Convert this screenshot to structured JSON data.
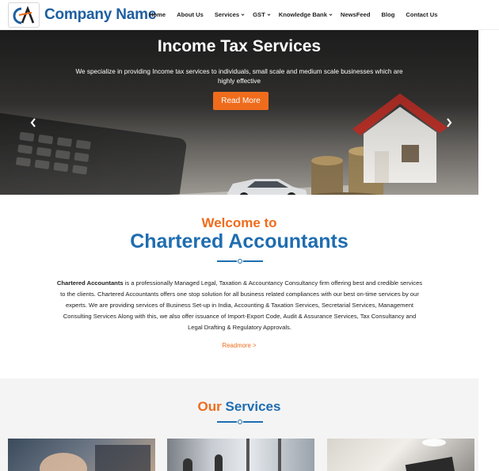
{
  "brand": {
    "name": "Company Name",
    "logo_letters": "CA"
  },
  "nav": {
    "items": [
      {
        "label": "Home",
        "dropdown": false
      },
      {
        "label": "About Us",
        "dropdown": false
      },
      {
        "label": "Services",
        "dropdown": true
      },
      {
        "label": "GST",
        "dropdown": true
      },
      {
        "label": "Knowledge Bank",
        "dropdown": true
      },
      {
        "label": "NewsFeed",
        "dropdown": false
      },
      {
        "label": "Blog",
        "dropdown": false
      },
      {
        "label": "Contact Us",
        "dropdown": false
      }
    ]
  },
  "hero": {
    "title": "Income Tax Services",
    "subtitle": "We specialize in providing Income tax services to individuals, small scale and medium scale businesses which are highly effective",
    "button": "Read More"
  },
  "welcome": {
    "top": "Welcome to",
    "main": "Chartered Accountants",
    "about_bold": "Chartered Accountants",
    "about_rest": " is a professionally Managed Legal, Taxation & Accountancy Consultancy firm offering best and credible services to the clients. Chartered Accountants offers one stop solution for all business related compliances with our best on-time services by our experts. We are providing services of Business Set-up in India, Accounting & Taxation Services, Secretarial Services, Management Consulting Services Along with this, we also offer issuance of Import-Export Code, Audit & Assurance Services, Tax Consultancy and Legal Drafting & Regulatory Approvals.",
    "readmore": "Readmore >"
  },
  "services": {
    "title_orange": "Our",
    "title_blue": "Services"
  },
  "colors": {
    "accent": "#ef6c1c",
    "brand_blue": "#1f6db0"
  },
  "icons": [
    "ca-logo-icon",
    "chevron-down-icon",
    "chevron-left-icon",
    "chevron-right-icon"
  ]
}
